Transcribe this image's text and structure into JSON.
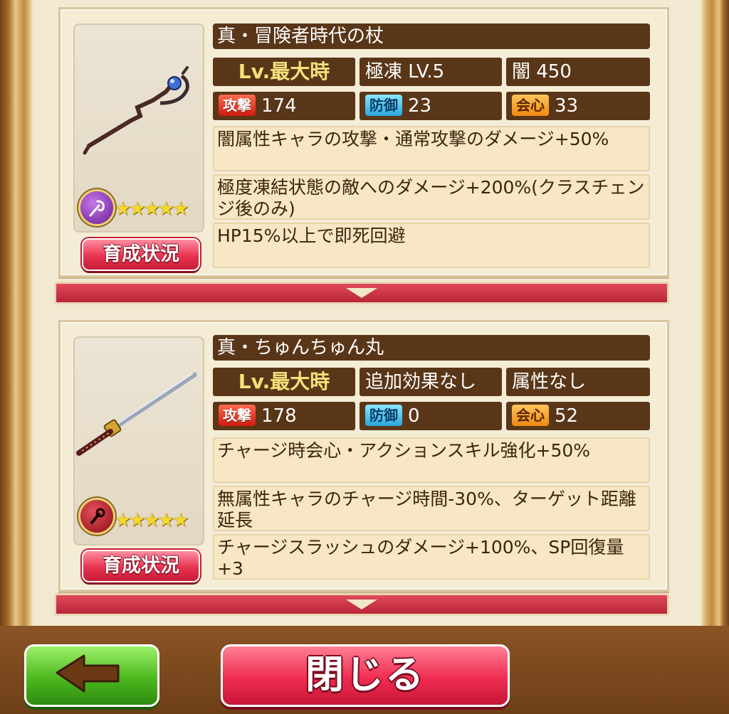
{
  "weapons": [
    {
      "name": "真・冒険者時代の杖",
      "level": "Lv.最大時",
      "special": "極凍 LV.5",
      "element": "闇 450",
      "stats": {
        "atk_label": "攻撃",
        "atk": "174",
        "def_label": "防御",
        "def": "23",
        "crit_label": "会心",
        "crit": "33"
      },
      "rarity": "★★★★★",
      "train_label": "育成状況",
      "element_icon": "dark-element-icon",
      "weapon_icon": "staff-icon",
      "effects": [
        "闇属性キャラの攻撃・通常攻撃のダメージ+50%",
        "極度凍結状態の敵へのダメージ+200%(クラスチェンジ後のみ)",
        "HP15%以上で即死回避"
      ]
    },
    {
      "name": "真・ちゅんちゅん丸",
      "level": "Lv.最大時",
      "special": "追加効果なし",
      "element": "属性なし",
      "stats": {
        "atk_label": "攻撃",
        "atk": "178",
        "def_label": "防御",
        "def": "0",
        "crit_label": "会心",
        "crit": "52"
      },
      "rarity": "★★★★★",
      "train_label": "育成状況",
      "element_icon": "no-element-icon",
      "weapon_icon": "katana-icon",
      "effects": [
        "チャージ時会心・アクションスキル強化+50%",
        "無属性キャラのチャージ時間-30%、ターゲット距離延長",
        "チャージスラッシュのダメージ+100%、SP回復量+3"
      ]
    }
  ],
  "footer": {
    "back_icon": "left-arrow-icon",
    "close_label": "閉じる"
  },
  "colors": {
    "frame": "#7a4c22",
    "label_bar": "#5a3618",
    "effect_bg": "#f7e7c4",
    "close_button": "#ef2c50",
    "back_button": "#4cb81e"
  }
}
